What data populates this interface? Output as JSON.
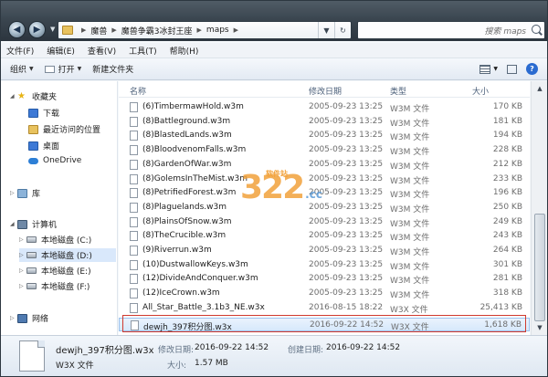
{
  "address": {
    "crumbs": [
      "魔兽",
      "魔兽争霸3冰封王座",
      "maps"
    ],
    "search_placeholder": "搜索 maps"
  },
  "menu": [
    "文件(F)",
    "编辑(E)",
    "查看(V)",
    "工具(T)",
    "帮助(H)"
  ],
  "toolbar": {
    "organize": "组织",
    "open": "打开",
    "new_folder": "新建文件夹"
  },
  "nav": {
    "favorites": "收藏夹",
    "downloads": "下载",
    "recent": "最近访问的位置",
    "desktop": "桌面",
    "onedrive": "OneDrive",
    "libraries": "库",
    "computer": "计算机",
    "drive_c": "本地磁盘 (C:)",
    "drive_d": "本地磁盘 (D:)",
    "drive_e": "本地磁盘 (E:)",
    "drive_f": "本地磁盘 (F:)",
    "network": "网络"
  },
  "columns": {
    "name": "名称",
    "modified": "修改日期",
    "type": "类型",
    "size": "大小"
  },
  "files": [
    {
      "name": "(6)TimbermawHold.w3m",
      "date": "2005-09-23 13:25",
      "type": "W3M 文件",
      "size": "170 KB"
    },
    {
      "name": "(8)Battleground.w3m",
      "date": "2005-09-23 13:25",
      "type": "W3M 文件",
      "size": "181 KB"
    },
    {
      "name": "(8)BlastedLands.w3m",
      "date": "2005-09-23 13:25",
      "type": "W3M 文件",
      "size": "194 KB"
    },
    {
      "name": "(8)BloodvenomFalls.w3m",
      "date": "2005-09-23 13:25",
      "type": "W3M 文件",
      "size": "228 KB"
    },
    {
      "name": "(8)GardenOfWar.w3m",
      "date": "2005-09-23 13:25",
      "type": "W3M 文件",
      "size": "212 KB"
    },
    {
      "name": "(8)GolemsInTheMist.w3m",
      "date": "2005-09-23 13:25",
      "type": "W3M 文件",
      "size": "233 KB"
    },
    {
      "name": "(8)PetrifiedForest.w3m",
      "date": "2005-09-23 13:25",
      "type": "W3M 文件",
      "size": "196 KB"
    },
    {
      "name": "(8)Plaguelands.w3m",
      "date": "2005-09-23 13:25",
      "type": "W3M 文件",
      "size": "250 KB"
    },
    {
      "name": "(8)PlainsOfSnow.w3m",
      "date": "2005-09-23 13:25",
      "type": "W3M 文件",
      "size": "249 KB"
    },
    {
      "name": "(8)TheCrucible.w3m",
      "date": "2005-09-23 13:25",
      "type": "W3M 文件",
      "size": "243 KB"
    },
    {
      "name": "(9)Riverrun.w3m",
      "date": "2005-09-23 13:25",
      "type": "W3M 文件",
      "size": "264 KB"
    },
    {
      "name": "(10)DustwallowKeys.w3m",
      "date": "2005-09-23 13:25",
      "type": "W3M 文件",
      "size": "301 KB"
    },
    {
      "name": "(12)DivideAndConquer.w3m",
      "date": "2005-09-23 13:25",
      "type": "W3M 文件",
      "size": "281 KB"
    },
    {
      "name": "(12)IceCrown.w3m",
      "date": "2005-09-23 13:25",
      "type": "W3M 文件",
      "size": "318 KB"
    },
    {
      "name": "All_Star_Battle_3.1b3_NE.w3x",
      "date": "2016-08-15 18:22",
      "type": "W3X 文件",
      "size": "25,413 KB"
    },
    {
      "name": "dewjh_397积分图.w3x",
      "date": "2016-09-22 14:52",
      "type": "W3X 文件",
      "size": "1,618 KB"
    }
  ],
  "details": {
    "filename": "dewjh_397积分图.w3x",
    "filetype": "W3X 文件",
    "modified_label": "修改日期:",
    "modified_value": "2016-09-22 14:52",
    "created_label": "创建日期:",
    "created_value": "2016-09-22 14:52",
    "size_label": "大小:",
    "size_value": "1.57 MB"
  },
  "watermark": {
    "number": "322",
    "suffix": ".cc",
    "tag": "软件站"
  },
  "icons": [
    "back-icon",
    "forward-icon",
    "folder-icon",
    "refresh-icon",
    "search-icon",
    "star-icon",
    "drive-icon",
    "network-icon",
    "file-icon",
    "help-icon"
  ],
  "colors": {
    "highlight": "#d03a2f",
    "selection": "#d6e8fc",
    "titlebar": "#3b4650"
  }
}
